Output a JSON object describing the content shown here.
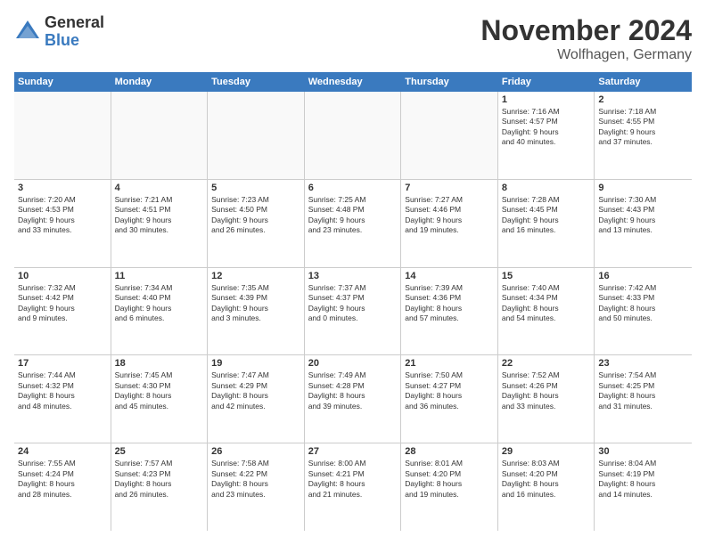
{
  "logo": {
    "general": "General",
    "blue": "Blue"
  },
  "title": "November 2024",
  "location": "Wolfhagen, Germany",
  "header_days": [
    "Sunday",
    "Monday",
    "Tuesday",
    "Wednesday",
    "Thursday",
    "Friday",
    "Saturday"
  ],
  "weeks": [
    [
      {
        "day": "",
        "info": "",
        "empty": true
      },
      {
        "day": "",
        "info": "",
        "empty": true
      },
      {
        "day": "",
        "info": "",
        "empty": true
      },
      {
        "day": "",
        "info": "",
        "empty": true
      },
      {
        "day": "",
        "info": "",
        "empty": true
      },
      {
        "day": "1",
        "info": "Sunrise: 7:16 AM\nSunset: 4:57 PM\nDaylight: 9 hours\nand 40 minutes.",
        "empty": false
      },
      {
        "day": "2",
        "info": "Sunrise: 7:18 AM\nSunset: 4:55 PM\nDaylight: 9 hours\nand 37 minutes.",
        "empty": false
      }
    ],
    [
      {
        "day": "3",
        "info": "Sunrise: 7:20 AM\nSunset: 4:53 PM\nDaylight: 9 hours\nand 33 minutes.",
        "empty": false
      },
      {
        "day": "4",
        "info": "Sunrise: 7:21 AM\nSunset: 4:51 PM\nDaylight: 9 hours\nand 30 minutes.",
        "empty": false
      },
      {
        "day": "5",
        "info": "Sunrise: 7:23 AM\nSunset: 4:50 PM\nDaylight: 9 hours\nand 26 minutes.",
        "empty": false
      },
      {
        "day": "6",
        "info": "Sunrise: 7:25 AM\nSunset: 4:48 PM\nDaylight: 9 hours\nand 23 minutes.",
        "empty": false
      },
      {
        "day": "7",
        "info": "Sunrise: 7:27 AM\nSunset: 4:46 PM\nDaylight: 9 hours\nand 19 minutes.",
        "empty": false
      },
      {
        "day": "8",
        "info": "Sunrise: 7:28 AM\nSunset: 4:45 PM\nDaylight: 9 hours\nand 16 minutes.",
        "empty": false
      },
      {
        "day": "9",
        "info": "Sunrise: 7:30 AM\nSunset: 4:43 PM\nDaylight: 9 hours\nand 13 minutes.",
        "empty": false
      }
    ],
    [
      {
        "day": "10",
        "info": "Sunrise: 7:32 AM\nSunset: 4:42 PM\nDaylight: 9 hours\nand 9 minutes.",
        "empty": false
      },
      {
        "day": "11",
        "info": "Sunrise: 7:34 AM\nSunset: 4:40 PM\nDaylight: 9 hours\nand 6 minutes.",
        "empty": false
      },
      {
        "day": "12",
        "info": "Sunrise: 7:35 AM\nSunset: 4:39 PM\nDaylight: 9 hours\nand 3 minutes.",
        "empty": false
      },
      {
        "day": "13",
        "info": "Sunrise: 7:37 AM\nSunset: 4:37 PM\nDaylight: 9 hours\nand 0 minutes.",
        "empty": false
      },
      {
        "day": "14",
        "info": "Sunrise: 7:39 AM\nSunset: 4:36 PM\nDaylight: 8 hours\nand 57 minutes.",
        "empty": false
      },
      {
        "day": "15",
        "info": "Sunrise: 7:40 AM\nSunset: 4:34 PM\nDaylight: 8 hours\nand 54 minutes.",
        "empty": false
      },
      {
        "day": "16",
        "info": "Sunrise: 7:42 AM\nSunset: 4:33 PM\nDaylight: 8 hours\nand 50 minutes.",
        "empty": false
      }
    ],
    [
      {
        "day": "17",
        "info": "Sunrise: 7:44 AM\nSunset: 4:32 PM\nDaylight: 8 hours\nand 48 minutes.",
        "empty": false
      },
      {
        "day": "18",
        "info": "Sunrise: 7:45 AM\nSunset: 4:30 PM\nDaylight: 8 hours\nand 45 minutes.",
        "empty": false
      },
      {
        "day": "19",
        "info": "Sunrise: 7:47 AM\nSunset: 4:29 PM\nDaylight: 8 hours\nand 42 minutes.",
        "empty": false
      },
      {
        "day": "20",
        "info": "Sunrise: 7:49 AM\nSunset: 4:28 PM\nDaylight: 8 hours\nand 39 minutes.",
        "empty": false
      },
      {
        "day": "21",
        "info": "Sunrise: 7:50 AM\nSunset: 4:27 PM\nDaylight: 8 hours\nand 36 minutes.",
        "empty": false
      },
      {
        "day": "22",
        "info": "Sunrise: 7:52 AM\nSunset: 4:26 PM\nDaylight: 8 hours\nand 33 minutes.",
        "empty": false
      },
      {
        "day": "23",
        "info": "Sunrise: 7:54 AM\nSunset: 4:25 PM\nDaylight: 8 hours\nand 31 minutes.",
        "empty": false
      }
    ],
    [
      {
        "day": "24",
        "info": "Sunrise: 7:55 AM\nSunset: 4:24 PM\nDaylight: 8 hours\nand 28 minutes.",
        "empty": false
      },
      {
        "day": "25",
        "info": "Sunrise: 7:57 AM\nSunset: 4:23 PM\nDaylight: 8 hours\nand 26 minutes.",
        "empty": false
      },
      {
        "day": "26",
        "info": "Sunrise: 7:58 AM\nSunset: 4:22 PM\nDaylight: 8 hours\nand 23 minutes.",
        "empty": false
      },
      {
        "day": "27",
        "info": "Sunrise: 8:00 AM\nSunset: 4:21 PM\nDaylight: 8 hours\nand 21 minutes.",
        "empty": false
      },
      {
        "day": "28",
        "info": "Sunrise: 8:01 AM\nSunset: 4:20 PM\nDaylight: 8 hours\nand 19 minutes.",
        "empty": false
      },
      {
        "day": "29",
        "info": "Sunrise: 8:03 AM\nSunset: 4:20 PM\nDaylight: 8 hours\nand 16 minutes.",
        "empty": false
      },
      {
        "day": "30",
        "info": "Sunrise: 8:04 AM\nSunset: 4:19 PM\nDaylight: 8 hours\nand 14 minutes.",
        "empty": false
      }
    ]
  ]
}
